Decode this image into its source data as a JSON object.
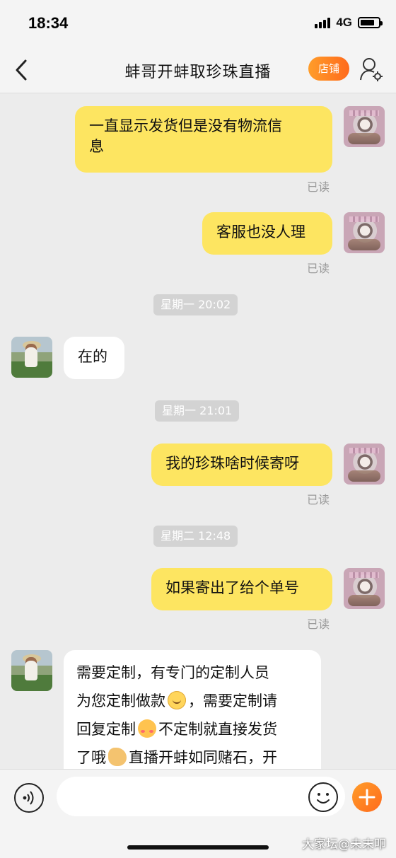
{
  "status_bar": {
    "time": "18:34",
    "network": "4G"
  },
  "nav": {
    "title": "蚌哥开蚌取珍珠直播",
    "shop_label": "店铺"
  },
  "icons": {
    "back": "chevron-left-icon",
    "profile": "user-settings-icon",
    "voice": "voice-icon",
    "emoji": "smiley-icon",
    "plus": "plus-icon"
  },
  "colors": {
    "outgoing_bubble": "#fde561",
    "incoming_bubble": "#ffffff",
    "accent": "#ff7a22"
  },
  "messages": [
    {
      "type": "outgoing",
      "line1": "一直显示发货但是没有物流信",
      "line2": "息",
      "status": "已读"
    },
    {
      "type": "outgoing",
      "text": "客服也没人理",
      "status": "已读"
    },
    {
      "type": "time",
      "text": "星期一 20:02"
    },
    {
      "type": "incoming",
      "text": "在的"
    },
    {
      "type": "time",
      "text": "星期一 21:01"
    },
    {
      "type": "outgoing",
      "text": "我的珍珠啥时候寄呀",
      "status": "已读"
    },
    {
      "type": "time",
      "text": "星期二 12:48"
    },
    {
      "type": "outgoing",
      "text": "如果寄出了给个单号",
      "status": "已读"
    },
    {
      "type": "incoming",
      "line1": "需要定制，有专门的定制人员",
      "line2a": "为您定制做款",
      "line2b": "，需要定制请",
      "line3a": "回复定制",
      "line3b": "不定制就直接发货",
      "line4a": "了哦",
      "line4b": "直播开蚌如同赌石，开"
    }
  ],
  "input": {
    "placeholder": ""
  },
  "watermark": "大家坛@未末叩"
}
